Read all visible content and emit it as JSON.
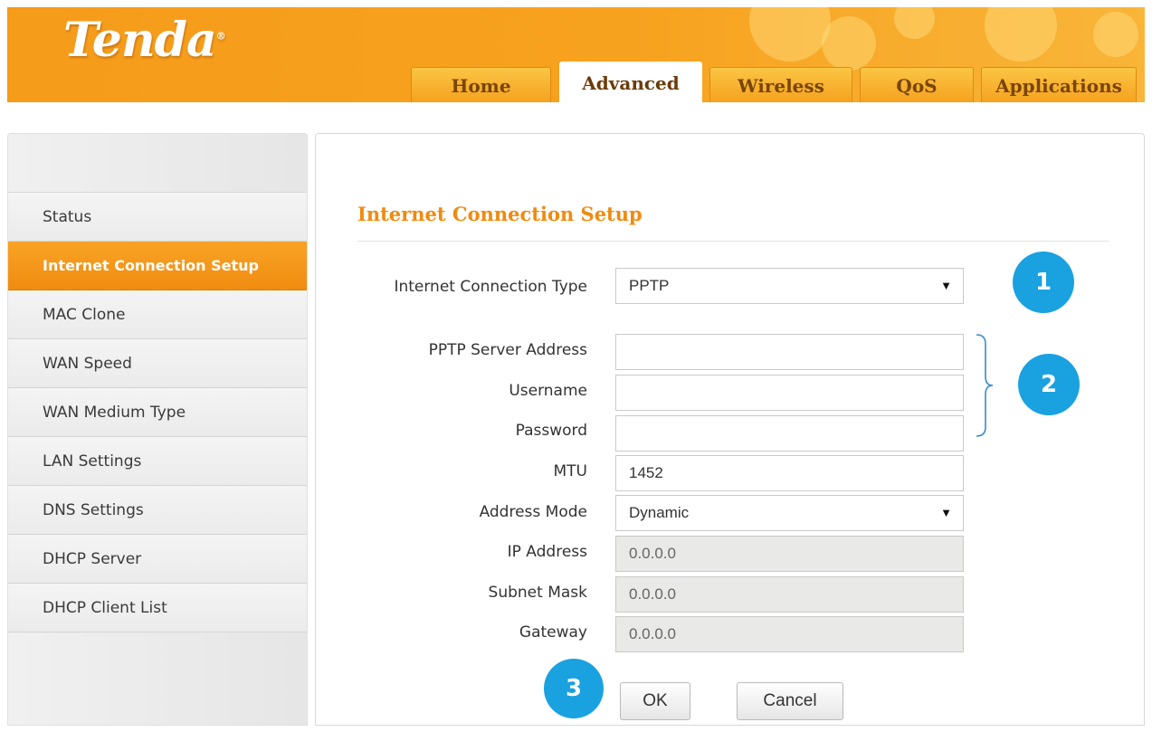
{
  "brand": {
    "logo_text": "Tenda",
    "logo_mark": "®"
  },
  "tabs": [
    {
      "label": "Home",
      "active": false
    },
    {
      "label": "Advanced",
      "active": true
    },
    {
      "label": "Wireless",
      "active": false
    },
    {
      "label": "QoS",
      "active": false
    },
    {
      "label": "Applications",
      "active": false
    }
  ],
  "sidebar": {
    "items": [
      {
        "label": "Status",
        "active": false
      },
      {
        "label": "Internet Connection Setup",
        "active": true
      },
      {
        "label": "MAC Clone",
        "active": false
      },
      {
        "label": "WAN Speed",
        "active": false
      },
      {
        "label": "WAN Medium Type",
        "active": false
      },
      {
        "label": "LAN Settings",
        "active": false
      },
      {
        "label": "DNS Settings",
        "active": false
      },
      {
        "label": "DHCP Server",
        "active": false
      },
      {
        "label": "DHCP Client List",
        "active": false
      }
    ]
  },
  "form": {
    "title": "Internet Connection Setup",
    "connection_type": {
      "label": "Internet Connection Type",
      "value": "PPTP"
    },
    "server_address": {
      "label": "PPTP Server Address",
      "value": ""
    },
    "username": {
      "label": "Username",
      "value": ""
    },
    "password": {
      "label": "Password",
      "value": ""
    },
    "mtu": {
      "label": "MTU",
      "value": "1452"
    },
    "address_mode": {
      "label": "Address Mode",
      "value": "Dynamic"
    },
    "ip_address": {
      "label": "IP Address",
      "value": "0.0.0.0"
    },
    "subnet_mask": {
      "label": "Subnet Mask",
      "value": "0.0.0.0"
    },
    "gateway": {
      "label": "Gateway",
      "value": "0.0.0.0"
    },
    "ok_label": "OK",
    "cancel_label": "Cancel",
    "dropdown_arrow": "▼"
  },
  "annotations": {
    "badge1": "1",
    "badge2": "2",
    "badge3": "3"
  },
  "colors": {
    "brand_orange": "#f59c1a",
    "title_orange": "#f18a0e",
    "badge_blue": "#1aa1e0"
  }
}
